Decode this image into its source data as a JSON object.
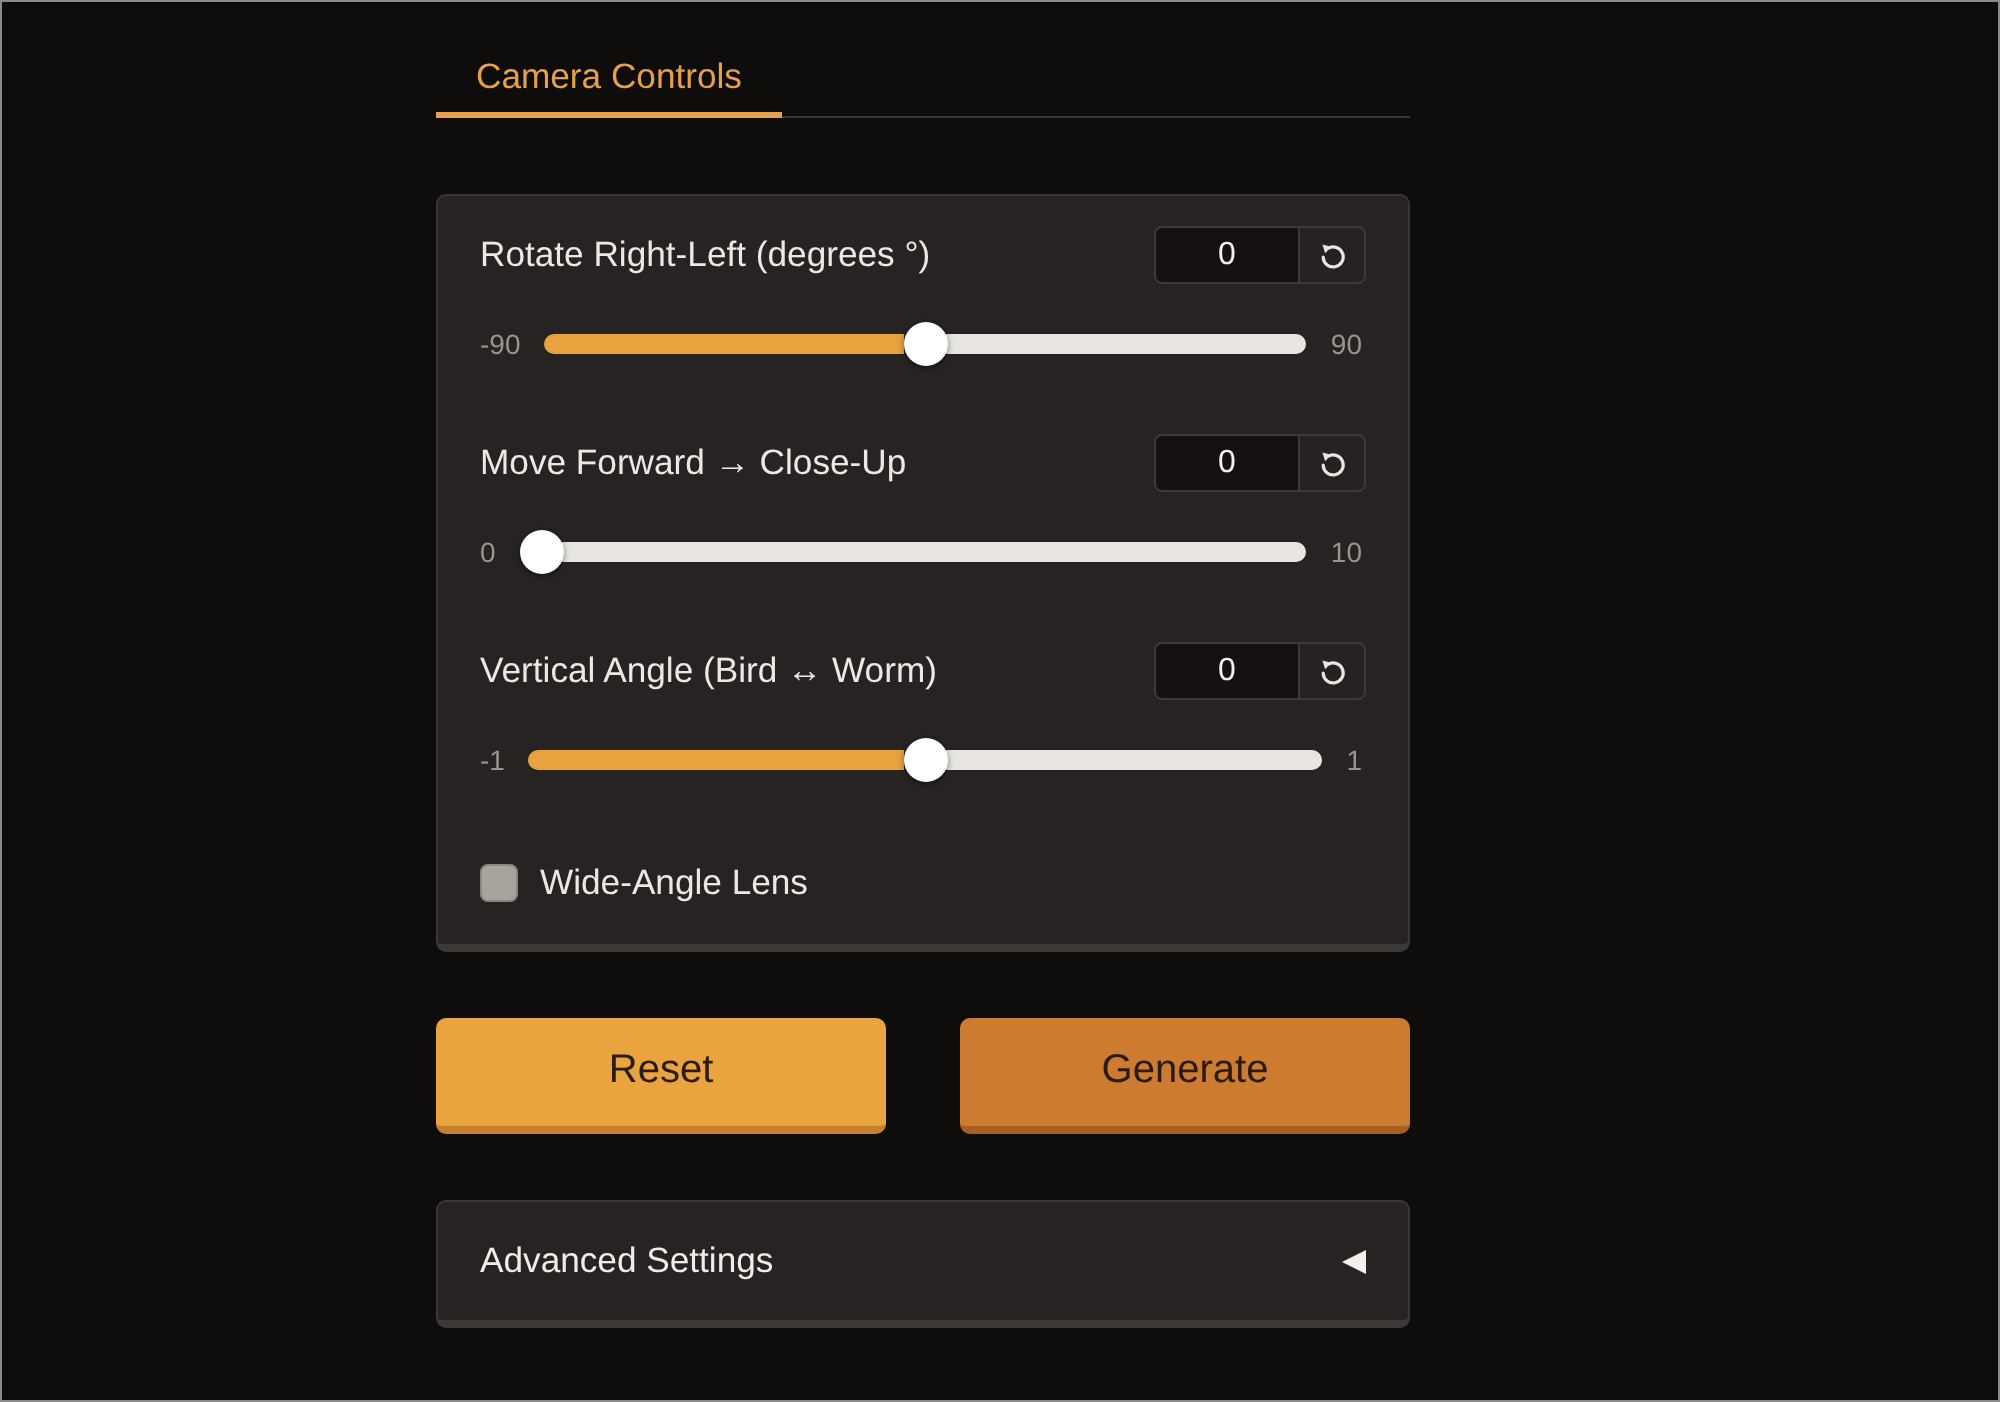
{
  "tabs": [
    {
      "label": "Camera Controls",
      "selected": true
    }
  ],
  "controls": [
    {
      "kind": "slider",
      "label": "Rotate Right-Left (degrees °)",
      "value": "0",
      "min": "-90",
      "max": "90",
      "level": 0.5
    },
    {
      "kind": "slider",
      "label": "Move Forward → Close-Up",
      "value": "0",
      "min": "0",
      "max": "10",
      "level": 0
    },
    {
      "kind": "slider",
      "label": "Vertical Angle (Bird ↔ Worm)",
      "value": "0",
      "min": "-1",
      "max": "1",
      "level": 0.5
    },
    {
      "kind": "checkbox",
      "label": "Wide-Angle Lens",
      "checked": false
    }
  ],
  "buttons": [
    {
      "label": "Reset",
      "kind": "secondary"
    },
    {
      "label": "Generate",
      "kind": "primary"
    }
  ],
  "accordion": {
    "label": "Advanced Settings",
    "expanded": false
  }
}
